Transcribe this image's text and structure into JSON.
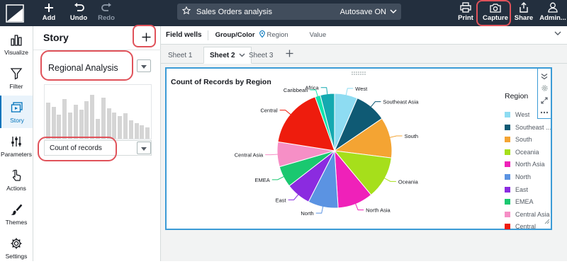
{
  "toolbar": {
    "add_label": "Add",
    "undo_label": "Undo",
    "redo_label": "Redo",
    "analysis_title": "Sales Orders analysis",
    "autosave_label": "Autosave ON",
    "print_label": "Print",
    "capture_label": "Capture",
    "share_label": "Share",
    "admin_label": "Admin..."
  },
  "rail": {
    "items": [
      {
        "label": "Visualize",
        "icon": "bar-chart-icon"
      },
      {
        "label": "Filter",
        "icon": "funnel-icon"
      },
      {
        "label": "Story",
        "icon": "story-icon"
      },
      {
        "label": "Parameters",
        "icon": "sliders-icon"
      },
      {
        "label": "Actions",
        "icon": "pointer-icon"
      },
      {
        "label": "Themes",
        "icon": "brush-icon"
      },
      {
        "label": "Settings",
        "icon": "gear-icon"
      }
    ]
  },
  "story": {
    "title": "Story",
    "scene_name": "Regional Analysis",
    "thumb_heights": [
      0.82,
      0.72,
      0.55,
      0.9,
      0.6,
      0.78,
      0.66,
      0.85,
      1.0,
      0.45,
      0.93,
      0.7,
      0.6,
      0.52,
      0.58,
      0.42,
      0.36,
      0.3,
      0.25
    ],
    "scene_label": "Count of records"
  },
  "field_wells": {
    "label": "Field wells",
    "group_color_label": "Group/Color",
    "group_color_value": "Region",
    "value_label": "Value"
  },
  "sheets": {
    "tabs": [
      "Sheet 1",
      "Sheet 2",
      "Sheet 3"
    ],
    "active": "Sheet 2"
  },
  "visual": {
    "title": "Count of Records by Region",
    "legend_title": "Region"
  },
  "colors": {
    "topbar": "#232f3e",
    "accent": "#0073bb",
    "highlight": "#e0525a",
    "visual_border": "#3b9bd6"
  },
  "chart_data": {
    "type": "pie",
    "title": "Count of Records by Region",
    "legend_title": "Region",
    "legend_placement": "right",
    "slices": [
      {
        "label": "West",
        "value": 6.5,
        "color": "#8edcf2"
      },
      {
        "label": "Southeast Asia",
        "value": 9.0,
        "color": "#0f5a74"
      },
      {
        "label": "South",
        "value": 11.5,
        "color": "#f4a433"
      },
      {
        "label": "Oceania",
        "value": 12.0,
        "color": "#a6df1b"
      },
      {
        "label": "North Asia",
        "value": 10.0,
        "color": "#ef21b9"
      },
      {
        "label": "North",
        "value": 8.5,
        "color": "#5b93e2"
      },
      {
        "label": "East",
        "value": 7.0,
        "color": "#8b2be0"
      },
      {
        "label": "EMEA",
        "value": 6.0,
        "color": "#1ac870"
      },
      {
        "label": "Central Asia",
        "value": 7.0,
        "color": "#f68fc6"
      },
      {
        "label": "Central",
        "value": 17.0,
        "color": "#ee1c0d"
      },
      {
        "label": "Caribbean",
        "value": 1.5,
        "color": "#12e3ac"
      },
      {
        "label": "Africa",
        "value": 4.0,
        "color": "#14a9b0"
      }
    ],
    "legend_order": [
      "West",
      "Southeast Asia",
      "South",
      "Oceania",
      "North Asia",
      "North",
      "East",
      "EMEA",
      "Central Asia",
      "Central"
    ],
    "legend_display": [
      "West",
      "Southeast ...",
      "South",
      "Oceania",
      "North Asia",
      "North",
      "East",
      "EMEA",
      "Central Asia",
      "Central"
    ]
  }
}
